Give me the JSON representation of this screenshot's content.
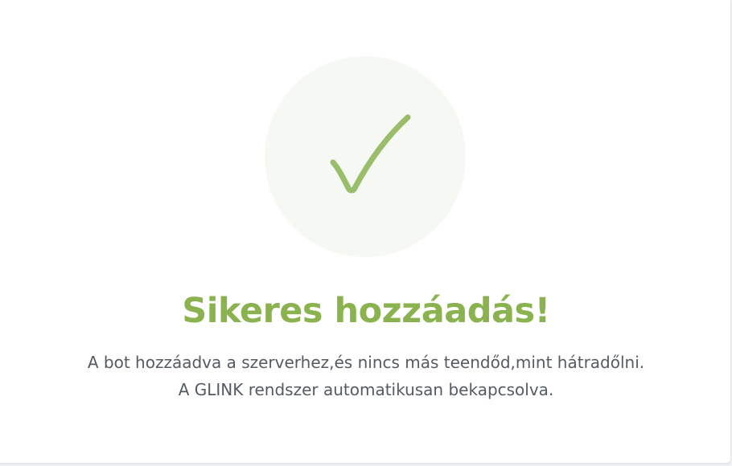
{
  "success": {
    "icon": "checkmark-icon",
    "accent_color": "#8ab34f",
    "circle_color": "#f6f9f3",
    "title": "Sikeres hozzáadás!",
    "message_line1": "A bot hozzáadva a szerverhez,és nincs más teendőd,mint hátradőlni.",
    "message_line2": "A GLINK rendszer automatikusan bekapcsolva."
  }
}
